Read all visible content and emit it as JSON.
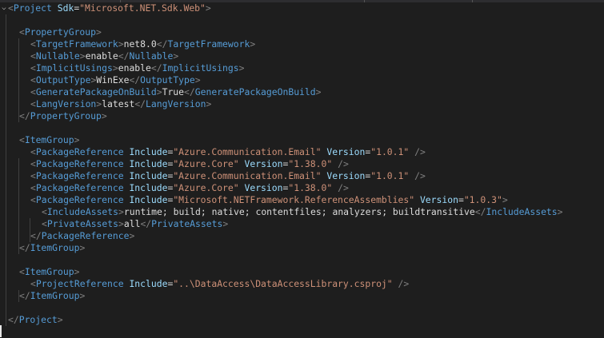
{
  "lines": [
    {
      "key": "l0",
      "tokens": [
        [
          "br",
          "<"
        ],
        [
          "tag",
          "Project"
        ],
        [
          "txt",
          " "
        ],
        [
          "atn",
          "Sdk"
        ],
        [
          "eq",
          "="
        ],
        [
          "val",
          "\"Microsoft.NET.Sdk.Web\""
        ],
        [
          "br",
          ">"
        ]
      ]
    },
    {
      "key": "l1",
      "tokens": []
    },
    {
      "key": "l2",
      "tokens": [
        [
          "br",
          "<"
        ],
        [
          "tag",
          "PropertyGroup"
        ],
        [
          "br",
          ">"
        ]
      ]
    },
    {
      "key": "l3",
      "tokens": [
        [
          "br",
          "<"
        ],
        [
          "tag",
          "TargetFramework"
        ],
        [
          "br",
          ">"
        ],
        [
          "txt",
          "net8.0"
        ],
        [
          "br",
          "</"
        ],
        [
          "tag",
          "TargetFramework"
        ],
        [
          "br",
          ">"
        ]
      ]
    },
    {
      "key": "l4",
      "tokens": [
        [
          "br",
          "<"
        ],
        [
          "tag",
          "Nullable"
        ],
        [
          "br",
          ">"
        ],
        [
          "txt",
          "enable"
        ],
        [
          "br",
          "</"
        ],
        [
          "tag",
          "Nullable"
        ],
        [
          "br",
          ">"
        ]
      ]
    },
    {
      "key": "l5",
      "tokens": [
        [
          "br",
          "<"
        ],
        [
          "tag",
          "ImplicitUsings"
        ],
        [
          "br",
          ">"
        ],
        [
          "txt",
          "enable"
        ],
        [
          "br",
          "</"
        ],
        [
          "tag",
          "ImplicitUsings"
        ],
        [
          "br",
          ">"
        ]
      ]
    },
    {
      "key": "l6",
      "tokens": [
        [
          "br",
          "<"
        ],
        [
          "tag",
          "OutputType"
        ],
        [
          "br",
          ">"
        ],
        [
          "txt",
          "WinExe"
        ],
        [
          "br",
          "</"
        ],
        [
          "tag",
          "OutputType"
        ],
        [
          "br",
          ">"
        ]
      ]
    },
    {
      "key": "l7",
      "tokens": [
        [
          "br",
          "<"
        ],
        [
          "tag",
          "GeneratePackageOnBuild"
        ],
        [
          "br",
          ">"
        ],
        [
          "txt",
          "True"
        ],
        [
          "br",
          "</"
        ],
        [
          "tag",
          "GeneratePackageOnBuild"
        ],
        [
          "br",
          ">"
        ]
      ]
    },
    {
      "key": "l8",
      "tokens": [
        [
          "br",
          "<"
        ],
        [
          "tag",
          "LangVersion"
        ],
        [
          "br",
          ">"
        ],
        [
          "txt",
          "latest"
        ],
        [
          "br",
          "</"
        ],
        [
          "tag",
          "LangVersion"
        ],
        [
          "br",
          ">"
        ]
      ]
    },
    {
      "key": "l9",
      "tokens": [
        [
          "br",
          "</"
        ],
        [
          "tag",
          "PropertyGroup"
        ],
        [
          "br",
          ">"
        ]
      ]
    },
    {
      "key": "l10",
      "tokens": []
    },
    {
      "key": "l11",
      "tokens": [
        [
          "br",
          "<"
        ],
        [
          "tag",
          "ItemGroup"
        ],
        [
          "br",
          ">"
        ]
      ]
    },
    {
      "key": "l12",
      "tokens": [
        [
          "br",
          "<"
        ],
        [
          "tag",
          "PackageReference"
        ],
        [
          "txt",
          " "
        ],
        [
          "atn",
          "Include"
        ],
        [
          "eq",
          "="
        ],
        [
          "val",
          "\"Azure.Communication.Email\""
        ],
        [
          "txt",
          " "
        ],
        [
          "atn",
          "Version"
        ],
        [
          "eq",
          "="
        ],
        [
          "val",
          "\"1.0.1\""
        ],
        [
          "txt",
          " "
        ],
        [
          "br",
          "/>"
        ]
      ]
    },
    {
      "key": "l13",
      "tokens": [
        [
          "br",
          "<"
        ],
        [
          "tag",
          "PackageReference"
        ],
        [
          "txt",
          " "
        ],
        [
          "atn",
          "Include"
        ],
        [
          "eq",
          "="
        ],
        [
          "val",
          "\"Azure.Core\""
        ],
        [
          "txt",
          " "
        ],
        [
          "atn",
          "Version"
        ],
        [
          "eq",
          "="
        ],
        [
          "val",
          "\"1.38.0\""
        ],
        [
          "txt",
          " "
        ],
        [
          "br",
          "/>"
        ]
      ]
    },
    {
      "key": "l14",
      "tokens": [
        [
          "br",
          "<"
        ],
        [
          "tag",
          "PackageReference"
        ],
        [
          "txt",
          " "
        ],
        [
          "atn",
          "Include"
        ],
        [
          "eq",
          "="
        ],
        [
          "val",
          "\"Azure.Communication.Email\""
        ],
        [
          "txt",
          " "
        ],
        [
          "atn",
          "Version"
        ],
        [
          "eq",
          "="
        ],
        [
          "val",
          "\"1.0.1\""
        ],
        [
          "txt",
          " "
        ],
        [
          "br",
          "/>"
        ]
      ]
    },
    {
      "key": "l15",
      "tokens": [
        [
          "br",
          "<"
        ],
        [
          "tag",
          "PackageReference"
        ],
        [
          "txt",
          " "
        ],
        [
          "atn",
          "Include"
        ],
        [
          "eq",
          "="
        ],
        [
          "val",
          "\"Azure.Core\""
        ],
        [
          "txt",
          " "
        ],
        [
          "atn",
          "Version"
        ],
        [
          "eq",
          "="
        ],
        [
          "val",
          "\"1.38.0\""
        ],
        [
          "txt",
          " "
        ],
        [
          "br",
          "/>"
        ]
      ]
    },
    {
      "key": "l16",
      "tokens": [
        [
          "br",
          "<"
        ],
        [
          "tag",
          "PackageReference"
        ],
        [
          "txt",
          " "
        ],
        [
          "atn",
          "Include"
        ],
        [
          "eq",
          "="
        ],
        [
          "val",
          "\"Microsoft.NETFramework.ReferenceAssemblies\""
        ],
        [
          "txt",
          " "
        ],
        [
          "atn",
          "Version"
        ],
        [
          "eq",
          "="
        ],
        [
          "val",
          "\"1.0.3\""
        ],
        [
          "br",
          ">"
        ]
      ]
    },
    {
      "key": "l17",
      "tokens": [
        [
          "br",
          "<"
        ],
        [
          "tag",
          "IncludeAssets"
        ],
        [
          "br",
          ">"
        ],
        [
          "txt",
          "runtime; build; native; contentfiles; analyzers; buildtransitive"
        ],
        [
          "br",
          "</"
        ],
        [
          "tag",
          "IncludeAssets"
        ],
        [
          "br",
          ">"
        ]
      ]
    },
    {
      "key": "l18",
      "tokens": [
        [
          "br",
          "<"
        ],
        [
          "tag",
          "PrivateAssets"
        ],
        [
          "br",
          ">"
        ],
        [
          "txt",
          "all"
        ],
        [
          "br",
          "</"
        ],
        [
          "tag",
          "PrivateAssets"
        ],
        [
          "br",
          ">"
        ]
      ]
    },
    {
      "key": "l19",
      "tokens": [
        [
          "br",
          "</"
        ],
        [
          "tag",
          "PackageReference"
        ],
        [
          "br",
          ">"
        ]
      ]
    },
    {
      "key": "l20",
      "tokens": [
        [
          "br",
          "</"
        ],
        [
          "tag",
          "ItemGroup"
        ],
        [
          "br",
          ">"
        ]
      ]
    },
    {
      "key": "l21",
      "tokens": []
    },
    {
      "key": "l22",
      "tokens": [
        [
          "br",
          "<"
        ],
        [
          "tag",
          "ItemGroup"
        ],
        [
          "br",
          ">"
        ]
      ]
    },
    {
      "key": "l23",
      "tokens": [
        [
          "br",
          "<"
        ],
        [
          "tag",
          "ProjectReference"
        ],
        [
          "txt",
          " "
        ],
        [
          "atn",
          "Include"
        ],
        [
          "eq",
          "="
        ],
        [
          "val",
          "\"..\\DataAccess\\DataAccessLibrary.csproj\""
        ],
        [
          "txt",
          " "
        ],
        [
          "br",
          "/>"
        ]
      ]
    },
    {
      "key": "l24",
      "tokens": [
        [
          "br",
          "</"
        ],
        [
          "tag",
          "ItemGroup"
        ],
        [
          "br",
          ">"
        ]
      ]
    },
    {
      "key": "l25",
      "tokens": []
    },
    {
      "key": "l26",
      "tokens": [
        [
          "br",
          "</"
        ],
        [
          "tag",
          "Project"
        ],
        [
          "br",
          ">"
        ]
      ]
    }
  ],
  "colors": {
    "background": "#1e1e1e",
    "bracket": "#808080",
    "tag": "#569cd6",
    "attribute": "#9cdcfe",
    "string": "#ce9178",
    "text": "#dcdcdc"
  },
  "icons": {
    "fold": "chevron-down-icon"
  }
}
